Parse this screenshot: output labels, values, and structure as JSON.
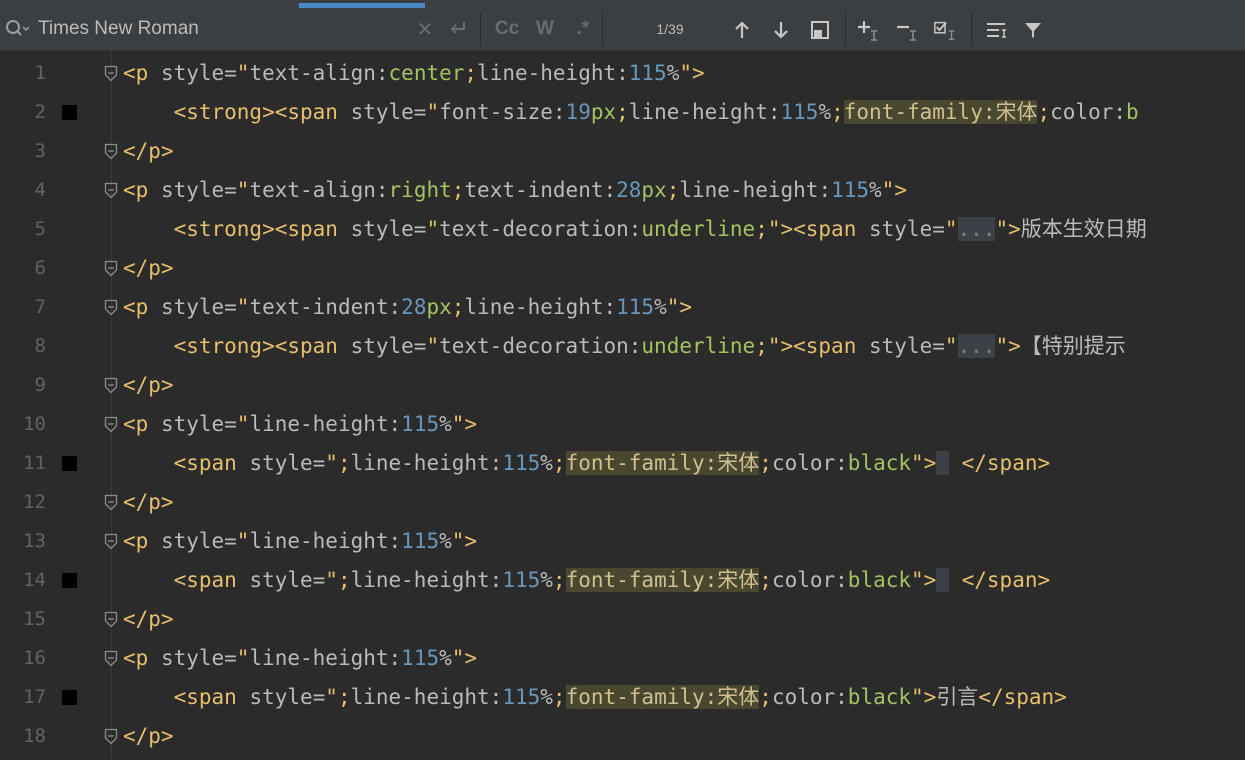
{
  "find_bar": {
    "search_value": "Times New Roman",
    "options": [
      "Cc",
      "W",
      ".*"
    ],
    "match_count": "1/39"
  },
  "icons": [
    "search-icon",
    "clear-icon",
    "new-line-icon",
    "match-case-icon",
    "words-icon",
    "regex-icon",
    "arrow-up-icon",
    "arrow-down-icon",
    "select-all-icon",
    "add-occurrence-icon",
    "remove-occurrence-icon",
    "toggle-occurrence-icon",
    "find-options-icon",
    "filter-icon"
  ],
  "colors": {
    "tag": "#e8bf6a",
    "attribute": "#bababa",
    "value": "#a5c261",
    "number": "#6897bb",
    "highlight": "#4a4730",
    "background": "#2b2b2b",
    "line_number": "#606366",
    "accent_tab": "#4a88c7"
  },
  "lines": [
    {
      "n": "1",
      "bookmark": false,
      "fold": true,
      "segments": [
        [
          "tag",
          "<p "
        ],
        [
          "attr",
          "style="
        ],
        [
          "tag",
          "\""
        ],
        [
          "attr",
          "text-align:"
        ],
        [
          "val",
          "center"
        ],
        [
          "tag",
          ";"
        ],
        [
          "attr",
          "line-height:"
        ],
        [
          "num",
          "115"
        ],
        [
          "attr",
          "%"
        ],
        [
          "tag",
          "\">"
        ]
      ]
    },
    {
      "n": "2",
      "bookmark": true,
      "fold": false,
      "segments": [
        [
          "plain",
          "    "
        ],
        [
          "tag",
          "<strong><span "
        ],
        [
          "attr",
          "style="
        ],
        [
          "tag",
          "\""
        ],
        [
          "attr",
          "font-size:"
        ],
        [
          "num",
          "19"
        ],
        [
          "val",
          "px"
        ],
        [
          "tag",
          ";"
        ],
        [
          "attr",
          "line-height:"
        ],
        [
          "num",
          "115"
        ],
        [
          "attr",
          "%"
        ],
        [
          "tag",
          ";"
        ],
        [
          "hl",
          "font-family:宋体"
        ],
        [
          "tag",
          ";"
        ],
        [
          "attr",
          "color:"
        ],
        [
          "val",
          "b"
        ]
      ]
    },
    {
      "n": "3",
      "bookmark": false,
      "fold": true,
      "segments": [
        [
          "tag",
          "</p>"
        ]
      ]
    },
    {
      "n": "4",
      "bookmark": false,
      "fold": true,
      "segments": [
        [
          "tag",
          "<p "
        ],
        [
          "attr",
          "style="
        ],
        [
          "tag",
          "\""
        ],
        [
          "attr",
          "text-align:"
        ],
        [
          "val",
          "right"
        ],
        [
          "tag",
          ";"
        ],
        [
          "attr",
          "text-indent:"
        ],
        [
          "num",
          "28"
        ],
        [
          "val",
          "px"
        ],
        [
          "tag",
          ";"
        ],
        [
          "attr",
          "line-height:"
        ],
        [
          "num",
          "115"
        ],
        [
          "attr",
          "%"
        ],
        [
          "tag",
          "\">"
        ]
      ]
    },
    {
      "n": "5",
      "bookmark": false,
      "fold": false,
      "segments": [
        [
          "plain",
          "    "
        ],
        [
          "tag",
          "<strong><span "
        ],
        [
          "attr",
          "style="
        ],
        [
          "tag",
          "\""
        ],
        [
          "attr",
          "text-decoration:"
        ],
        [
          "val",
          "underline"
        ],
        [
          "tag",
          ";\"><span "
        ],
        [
          "attr",
          "style="
        ],
        [
          "tag",
          "\""
        ],
        [
          "ph",
          "..."
        ],
        [
          "tag",
          "\">"
        ],
        [
          "text",
          "版本生效日期"
        ]
      ]
    },
    {
      "n": "6",
      "bookmark": false,
      "fold": true,
      "segments": [
        [
          "tag",
          "</p>"
        ]
      ]
    },
    {
      "n": "7",
      "bookmark": false,
      "fold": true,
      "segments": [
        [
          "tag",
          "<p "
        ],
        [
          "attr",
          "style="
        ],
        [
          "tag",
          "\""
        ],
        [
          "attr",
          "text-indent:"
        ],
        [
          "num",
          "28"
        ],
        [
          "val",
          "px"
        ],
        [
          "tag",
          ";"
        ],
        [
          "attr",
          "line-height:"
        ],
        [
          "num",
          "115"
        ],
        [
          "attr",
          "%"
        ],
        [
          "tag",
          "\">"
        ]
      ]
    },
    {
      "n": "8",
      "bookmark": false,
      "fold": false,
      "segments": [
        [
          "plain",
          "    "
        ],
        [
          "tag",
          "<strong><span "
        ],
        [
          "attr",
          "style="
        ],
        [
          "tag",
          "\""
        ],
        [
          "attr",
          "text-decoration:"
        ],
        [
          "val",
          "underline"
        ],
        [
          "tag",
          ";\"><span "
        ],
        [
          "attr",
          "style="
        ],
        [
          "tag",
          "\""
        ],
        [
          "ph",
          "..."
        ],
        [
          "tag",
          "\">"
        ],
        [
          "text",
          "【特别提示"
        ]
      ]
    },
    {
      "n": "9",
      "bookmark": false,
      "fold": true,
      "segments": [
        [
          "tag",
          "</p>"
        ]
      ]
    },
    {
      "n": "10",
      "bookmark": false,
      "fold": true,
      "segments": [
        [
          "tag",
          "<p "
        ],
        [
          "attr",
          "style="
        ],
        [
          "tag",
          "\""
        ],
        [
          "attr",
          "line-height:"
        ],
        [
          "num",
          "115"
        ],
        [
          "attr",
          "%"
        ],
        [
          "tag",
          "\">"
        ]
      ]
    },
    {
      "n": "11",
      "bookmark": true,
      "fold": false,
      "segments": [
        [
          "plain",
          "    "
        ],
        [
          "tag",
          "<span "
        ],
        [
          "attr",
          "style="
        ],
        [
          "tag",
          "\";"
        ],
        [
          "attr",
          "line-height:"
        ],
        [
          "num",
          "115"
        ],
        [
          "attr",
          "%"
        ],
        [
          "tag",
          ";"
        ],
        [
          "hl",
          "font-family:宋体"
        ],
        [
          "tag",
          ";"
        ],
        [
          "attr",
          "color:"
        ],
        [
          "val",
          "black"
        ],
        [
          "tag",
          "\">"
        ],
        [
          "ph",
          " "
        ],
        [
          "plain",
          " "
        ],
        [
          "tag",
          "</span>"
        ]
      ]
    },
    {
      "n": "12",
      "bookmark": false,
      "fold": true,
      "segments": [
        [
          "tag",
          "</p>"
        ]
      ]
    },
    {
      "n": "13",
      "bookmark": false,
      "fold": true,
      "segments": [
        [
          "tag",
          "<p "
        ],
        [
          "attr",
          "style="
        ],
        [
          "tag",
          "\""
        ],
        [
          "attr",
          "line-height:"
        ],
        [
          "num",
          "115"
        ],
        [
          "attr",
          "%"
        ],
        [
          "tag",
          "\">"
        ]
      ]
    },
    {
      "n": "14",
      "bookmark": true,
      "fold": false,
      "segments": [
        [
          "plain",
          "    "
        ],
        [
          "tag",
          "<span "
        ],
        [
          "attr",
          "style="
        ],
        [
          "tag",
          "\";"
        ],
        [
          "attr",
          "line-height:"
        ],
        [
          "num",
          "115"
        ],
        [
          "attr",
          "%"
        ],
        [
          "tag",
          ";"
        ],
        [
          "hl",
          "font-family:宋体"
        ],
        [
          "tag",
          ";"
        ],
        [
          "attr",
          "color:"
        ],
        [
          "val",
          "black"
        ],
        [
          "tag",
          "\">"
        ],
        [
          "ph",
          " "
        ],
        [
          "plain",
          " "
        ],
        [
          "tag",
          "</span>"
        ]
      ]
    },
    {
      "n": "15",
      "bookmark": false,
      "fold": true,
      "segments": [
        [
          "tag",
          "</p>"
        ]
      ]
    },
    {
      "n": "16",
      "bookmark": false,
      "fold": true,
      "segments": [
        [
          "tag",
          "<p "
        ],
        [
          "attr",
          "style="
        ],
        [
          "tag",
          "\""
        ],
        [
          "attr",
          "line-height:"
        ],
        [
          "num",
          "115"
        ],
        [
          "attr",
          "%"
        ],
        [
          "tag",
          "\">"
        ]
      ]
    },
    {
      "n": "17",
      "bookmark": true,
      "fold": false,
      "segments": [
        [
          "plain",
          "    "
        ],
        [
          "tag",
          "<span "
        ],
        [
          "attr",
          "style="
        ],
        [
          "tag",
          "\";"
        ],
        [
          "attr",
          "line-height:"
        ],
        [
          "num",
          "115"
        ],
        [
          "attr",
          "%"
        ],
        [
          "tag",
          ";"
        ],
        [
          "hl",
          "font-family:宋体"
        ],
        [
          "tag",
          ";"
        ],
        [
          "attr",
          "color:"
        ],
        [
          "val",
          "black"
        ],
        [
          "tag",
          "\">"
        ],
        [
          "text",
          "引言"
        ],
        [
          "tag",
          "</span>"
        ]
      ]
    },
    {
      "n": "18",
      "bookmark": false,
      "fold": true,
      "segments": [
        [
          "tag",
          "</p>"
        ]
      ]
    }
  ]
}
